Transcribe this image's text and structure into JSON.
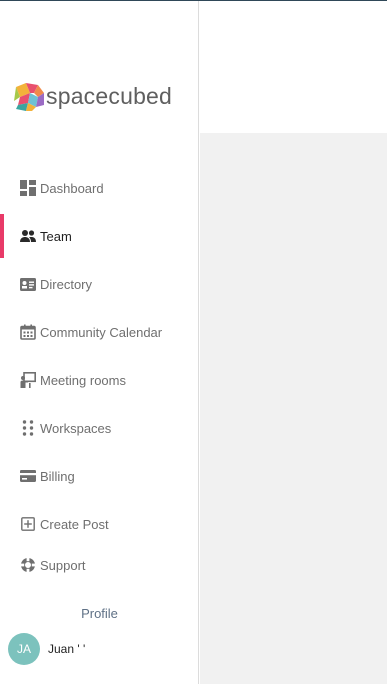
{
  "brand": {
    "name": "spacecubed",
    "logo_icon": "spacecubed-logo-mark",
    "accent_color": "#e83a68"
  },
  "nav": {
    "items": [
      {
        "label": "Dashboard",
        "icon": "dashboard-icon",
        "active": false
      },
      {
        "label": "Team",
        "icon": "team-icon",
        "active": true
      },
      {
        "label": "Directory",
        "icon": "directory-icon",
        "active": false
      },
      {
        "label": "Community Calendar",
        "icon": "calendar-icon",
        "active": false
      },
      {
        "label": "Meeting rooms",
        "icon": "meeting-room-icon",
        "active": false
      },
      {
        "label": "Workspaces",
        "icon": "workspaces-icon",
        "active": false
      },
      {
        "label": "Billing",
        "icon": "billing-icon",
        "active": false
      },
      {
        "label": "Create Post",
        "icon": "create-post-icon",
        "active": false
      },
      {
        "label": "Support",
        "icon": "support-icon",
        "active": false
      }
    ]
  },
  "profile": {
    "label": "Profile",
    "initials": "JA",
    "name": "Juan ' '"
  }
}
